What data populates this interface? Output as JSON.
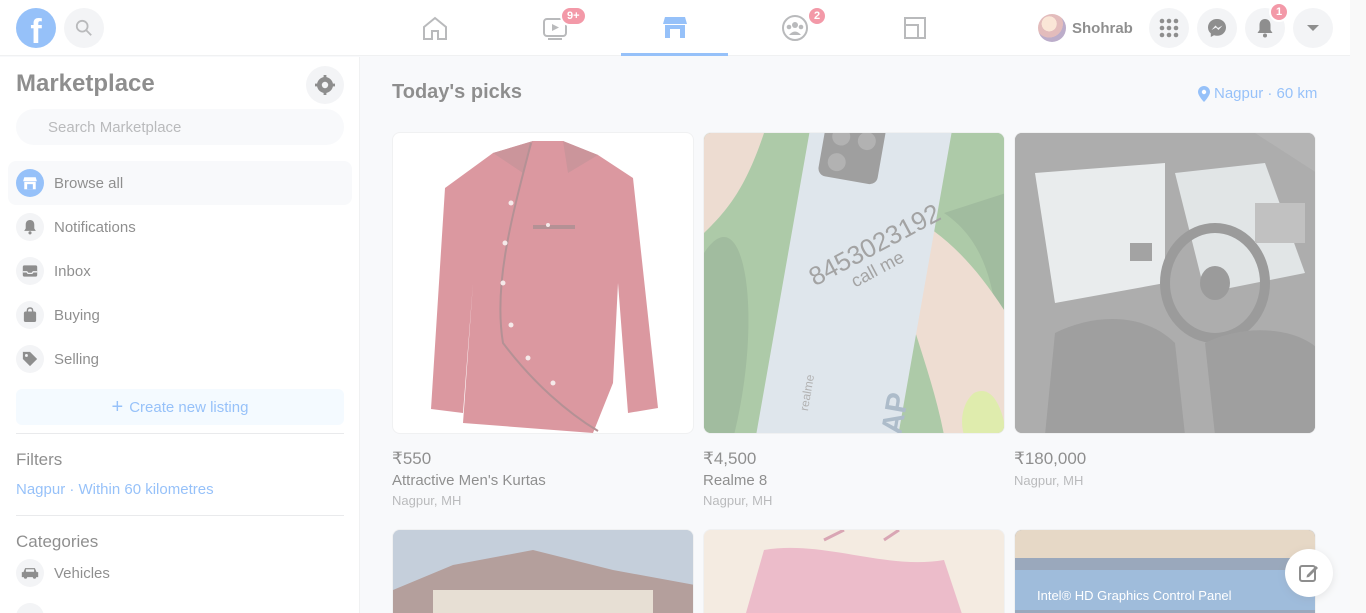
{
  "header": {
    "profile_name": "Shohrab",
    "watch_badge": "9+",
    "groups_badge": "2",
    "notifications_badge": "1"
  },
  "sidebar": {
    "title": "Marketplace",
    "search_placeholder": "Search Marketplace",
    "items": [
      {
        "label": "Browse all"
      },
      {
        "label": "Notifications"
      },
      {
        "label": "Inbox"
      },
      {
        "label": "Buying"
      },
      {
        "label": "Selling"
      }
    ],
    "create_listing_label": "Create new listing",
    "filters_heading": "Filters",
    "filter_location": "Nagpur · Within 60 kilometres",
    "categories_heading": "Categories",
    "categories": [
      {
        "label": "Vehicles"
      }
    ]
  },
  "main": {
    "title": "Today's picks",
    "location_label": "Nagpur · 60 km",
    "listings": [
      {
        "price": "₹550",
        "title": "Attractive Men's Kurtas",
        "location": "Nagpur, MH"
      },
      {
        "price": "₹4,500",
        "title": "Realme 8",
        "location": "Nagpur, MH"
      },
      {
        "price": "₹180,000",
        "title": "",
        "location": "Nagpur, MH"
      }
    ],
    "phone_overlay_text": "8453023192",
    "phone_overlay_sub": "call me",
    "phone_brand_text": "realme",
    "phone_leap_text": "LEAP",
    "row2_banner_text": "Intel® HD Graphics Control Panel"
  },
  "colors": {
    "brand": "#1877f2",
    "badge": "#e41e3f",
    "background": "#f0f2f5"
  }
}
